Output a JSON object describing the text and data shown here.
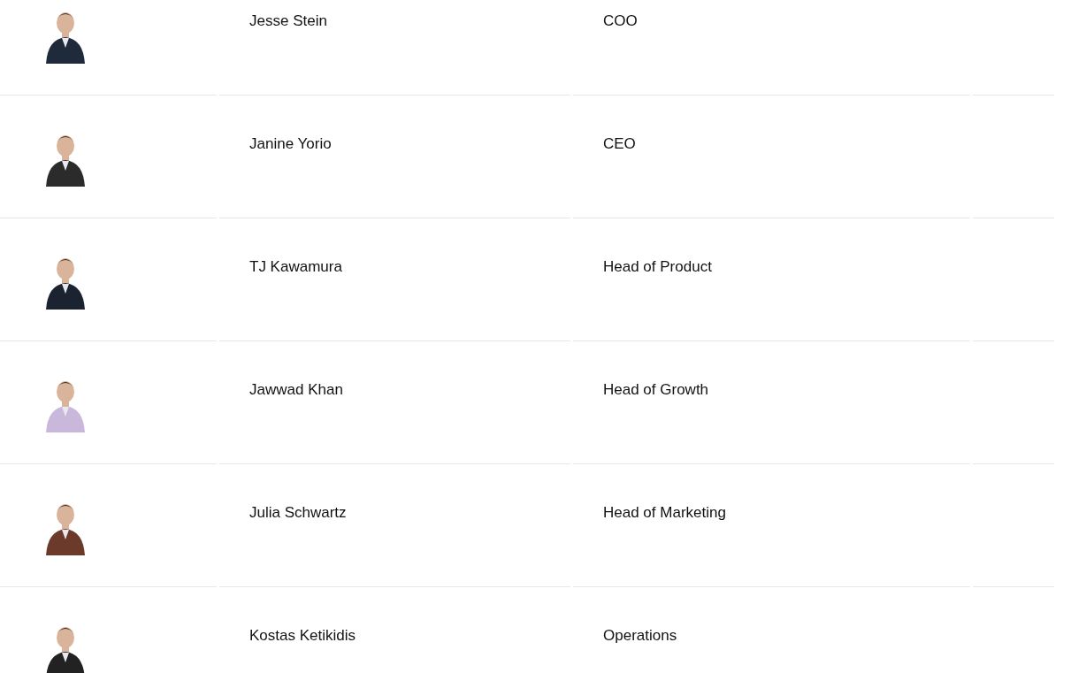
{
  "team": [
    {
      "name": "Jesse Stein",
      "role": "COO"
    },
    {
      "name": "Janine Yorio",
      "role": "CEO"
    },
    {
      "name": "TJ Kawamura",
      "role": "Head of Product"
    },
    {
      "name": "Jawwad Khan",
      "role": "Head of Growth"
    },
    {
      "name": "Julia Schwartz",
      "role": "Head of Marketing"
    },
    {
      "name": "Kostas Ketikidis",
      "role": "Operations"
    }
  ]
}
